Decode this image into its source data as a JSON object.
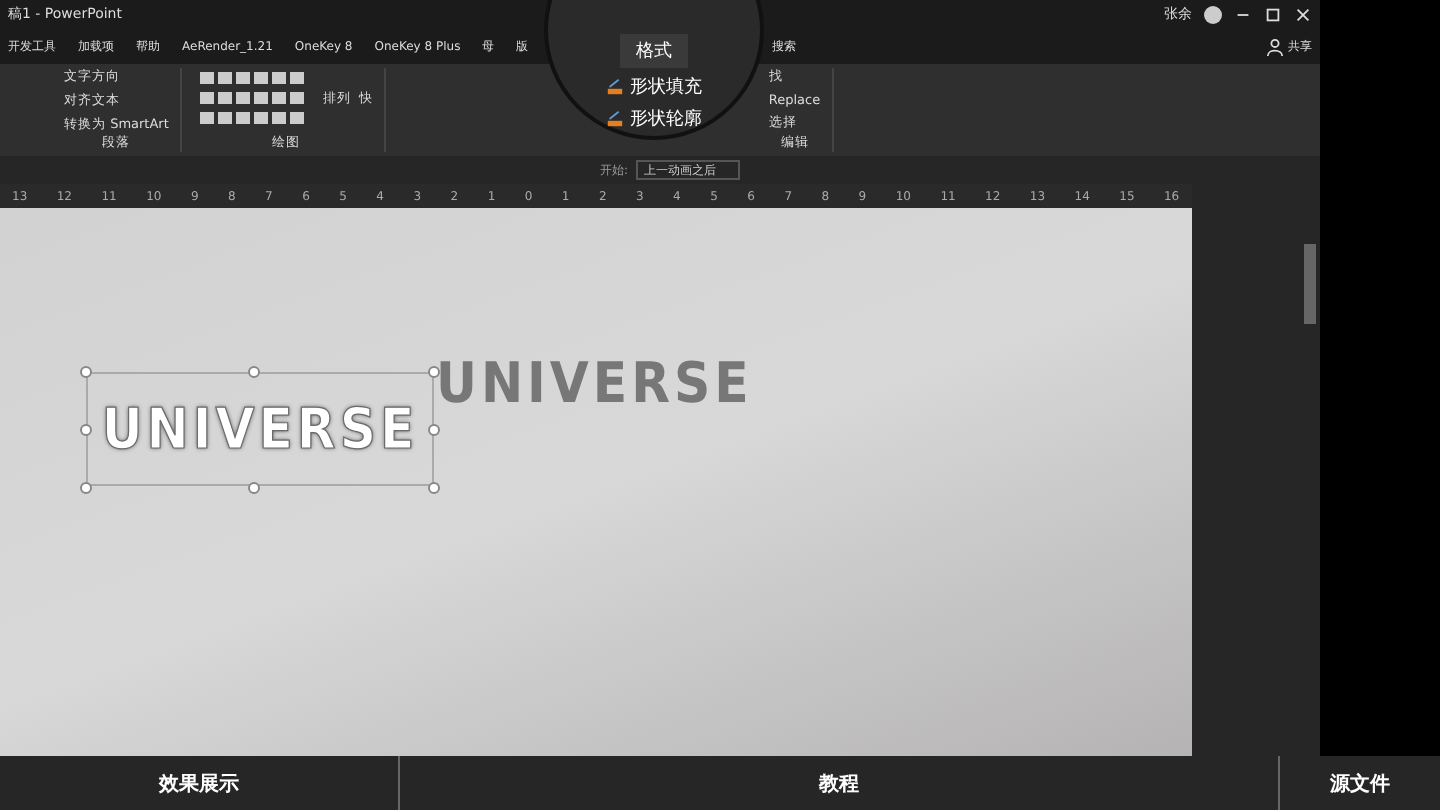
{
  "window": {
    "title": "稿1 - PowerPoint",
    "user": "张余"
  },
  "tabs": [
    {
      "label": "开发工具",
      "selected": false
    },
    {
      "label": "加载项",
      "selected": false
    },
    {
      "label": "帮助",
      "selected": false
    },
    {
      "label": "AeRender_1.21",
      "selected": false
    },
    {
      "label": "OneKey 8",
      "selected": false
    },
    {
      "label": "OneKey 8 Plus",
      "selected": false
    },
    {
      "label": "母",
      "selected": false
    },
    {
      "label": "版",
      "selected": false
    }
  ],
  "search": {
    "label": "搜索"
  },
  "share": {
    "label": "共享"
  },
  "magnifier": {
    "tab": {
      "label": "格式",
      "selected": true
    },
    "items": [
      "形状填充",
      "形状轮廓"
    ]
  },
  "ribbon": {
    "paragraph": {
      "commands": [
        "文字方向",
        "对齐文本",
        "转换为 SmartArt"
      ],
      "label": "段落"
    },
    "drawing": {
      "label": "绘图",
      "arrange": "排列",
      "quick": "快"
    },
    "editing": {
      "commands": [
        "找",
        "Replace",
        "选择"
      ],
      "label": "编辑"
    }
  },
  "animation_bar": {
    "start_label": "开始:",
    "start_value": "上一动画之后"
  },
  "ruler": {
    "ticks": [
      "13",
      "12",
      "11",
      "10",
      "9",
      "8",
      "7",
      "6",
      "5",
      "4",
      "3",
      "2",
      "1",
      "0",
      "1",
      "2",
      "3",
      "4",
      "5",
      "6",
      "7",
      "8",
      "9",
      "10",
      "11",
      "12",
      "13",
      "14",
      "15",
      "16"
    ]
  },
  "slide": {
    "texts": [
      {
        "text": "UNIVERSE",
        "selected": true
      },
      {
        "text": "UNIVERSE",
        "selected": false
      }
    ]
  },
  "bottom_bar": {
    "items": [
      "效果展示",
      "教程",
      "源文件"
    ]
  }
}
